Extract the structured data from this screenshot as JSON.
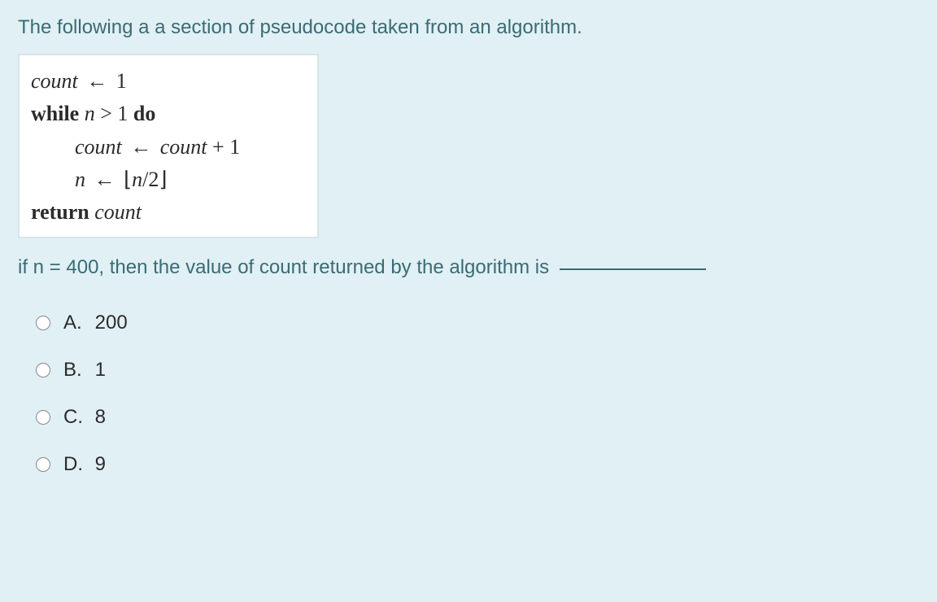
{
  "intro": "The following a a section of pseudocode taken from an algorithm.",
  "code": {
    "line1_var": "count",
    "assign1": "1",
    "while_kw": "while",
    "while_cond_var": "n",
    "while_cond_rest": " > 1 ",
    "do_kw": "do",
    "line3_var": "count",
    "line3_rhs_var": "count",
    "line3_rhs_rest": " + 1",
    "line4_var": "n",
    "line4_lfloor": "⌊",
    "line4_inner_var": "n",
    "line4_inner": "/2",
    "line4_rfloor": "⌋",
    "return_kw": "return",
    "return_var": "count"
  },
  "question": "if n = 400, then the value of count returned by the algorithm is ",
  "options": [
    {
      "letter": "A.",
      "text": "200"
    },
    {
      "letter": "B.",
      "text": "1"
    },
    {
      "letter": "C.",
      "text": "8"
    },
    {
      "letter": "D.",
      "text": "9"
    }
  ]
}
